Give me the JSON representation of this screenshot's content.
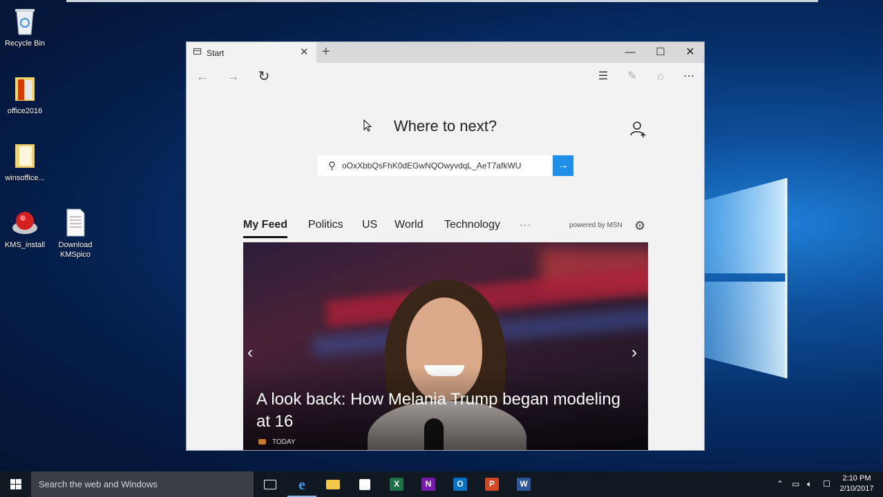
{
  "desktop": {
    "icons": [
      {
        "label": "Recycle Bin"
      },
      {
        "label": "office2016"
      },
      {
        "label": "winsoffice..."
      },
      {
        "label": "KMS_install"
      },
      {
        "label": "Download KMSpico"
      }
    ]
  },
  "browser": {
    "tab_title": "Start",
    "heading": "Where to next?",
    "search": {
      "value": "oOxXbbQsFhK0dEGwNQOwyvdqL_AeT7afkWU"
    },
    "feed_tabs": [
      "My Feed",
      "Politics",
      "US",
      "World",
      "Technology"
    ],
    "more_label": "···",
    "powered_by": "powered by MSN",
    "hero": {
      "headline": "A look back: How Melania Trump began modeling at 16",
      "source": "TODAY"
    }
  },
  "taskbar": {
    "search_placeholder": "Search the web and Windows",
    "apps": [
      {
        "icon": "task-view-icon"
      },
      {
        "icon": "edge-icon",
        "active": true
      },
      {
        "icon": "file-explorer-icon"
      },
      {
        "icon": "store-icon"
      },
      {
        "icon": "excel-icon",
        "letter": "X",
        "color": "#1e7145"
      },
      {
        "icon": "onenote-icon",
        "letter": "N",
        "color": "#7719aa"
      },
      {
        "icon": "outlook-icon",
        "letter": "O",
        "color": "#0072c6"
      },
      {
        "icon": "powerpoint-icon",
        "letter": "P",
        "color": "#d24726"
      },
      {
        "icon": "word-icon",
        "letter": "W",
        "color": "#2b579a"
      }
    ],
    "time": "2:10 PM",
    "date": "2/10/2017"
  },
  "colors": {
    "accent": "#1e8ee8",
    "taskbar": "#101822"
  }
}
